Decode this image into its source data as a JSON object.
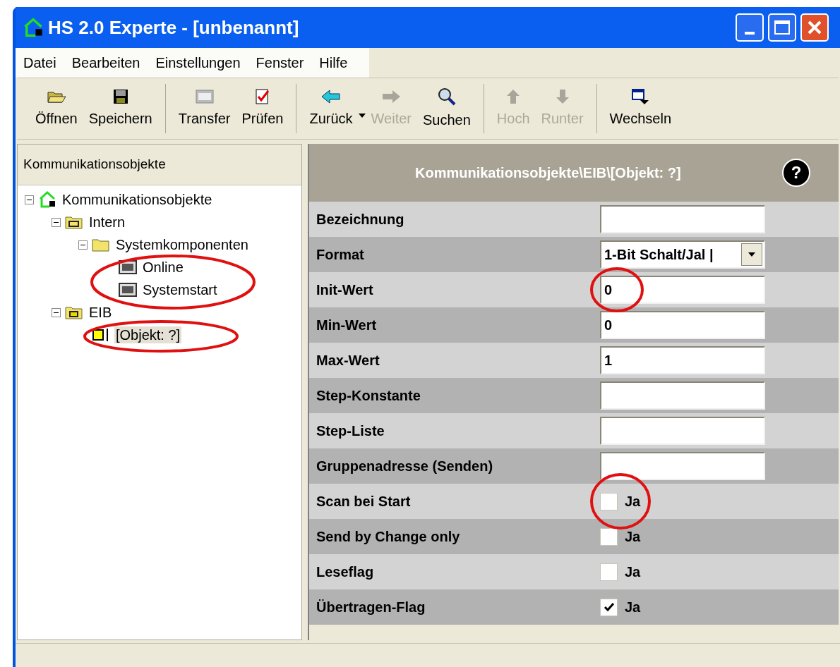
{
  "window": {
    "title": "HS 2.0 Experte - [unbenannt]"
  },
  "menu": [
    "Datei",
    "Bearbeiten",
    "Einstellungen",
    "Fenster",
    "Hilfe"
  ],
  "toolbar": [
    [
      {
        "label": "Öffnen",
        "disabled": false,
        "dropdown": false
      },
      {
        "label": "Speichern",
        "disabled": false,
        "dropdown": false
      }
    ],
    [
      {
        "label": "Transfer",
        "disabled": false,
        "dropdown": false
      },
      {
        "label": "Prüfen",
        "disabled": false,
        "dropdown": false
      }
    ],
    [
      {
        "label": "Zurück",
        "disabled": false,
        "dropdown": true
      },
      {
        "label": "Weiter",
        "disabled": true,
        "dropdown": false
      },
      {
        "label": "Suchen",
        "disabled": false,
        "dropdown": false
      }
    ],
    [
      {
        "label": "Hoch",
        "disabled": true,
        "dropdown": false
      },
      {
        "label": "Runter",
        "disabled": true,
        "dropdown": false
      }
    ],
    [
      {
        "label": "Wechseln",
        "disabled": false,
        "dropdown": false
      }
    ]
  ],
  "tree": {
    "title": "Kommunikationsobjekte",
    "items": [
      {
        "label": "Kommunikationsobjekte",
        "kind": "home",
        "expanded": true,
        "selected": false,
        "children": [
          {
            "label": "Intern",
            "kind": "hs-folder",
            "expanded": true,
            "selected": false,
            "children": [
              {
                "label": "Systemkomponenten",
                "kind": "folder",
                "expanded": true,
                "selected": false,
                "children": [
                  {
                    "label": "Online",
                    "kind": "hs-item",
                    "selected": false
                  },
                  {
                    "label": "Systemstart",
                    "kind": "hs-item",
                    "selected": false
                  }
                ]
              }
            ]
          },
          {
            "label": "EIB",
            "kind": "eib-folder",
            "expanded": true,
            "selected": false,
            "children": [
              {
                "label": "[Objekt: ?]",
                "kind": "object",
                "selected": true
              }
            ]
          }
        ]
      }
    ]
  },
  "properties": {
    "path": "Kommunikationsobjekte\\EIB\\[Objekt: ?]",
    "help": "?",
    "rows": [
      {
        "label": "Bezeichnung",
        "kind": "text"
      },
      {
        "label": "Format",
        "kind": "select",
        "value": "1-Bit Schalt/Jal |"
      },
      {
        "label": "Init-Wert",
        "kind": "text",
        "value": "0"
      },
      {
        "label": "Min-Wert",
        "kind": "text",
        "value": "0"
      },
      {
        "label": "Max-Wert",
        "kind": "text",
        "value": "1"
      },
      {
        "label": "Step-Konstante",
        "kind": "text"
      },
      {
        "label": "Step-Liste",
        "kind": "text"
      },
      {
        "label": "Gruppenadresse (Senden)",
        "kind": "text"
      },
      {
        "label": "Scan bei Start",
        "kind": "checkbox",
        "checked": false,
        "option": "Ja"
      },
      {
        "label": "Send by Change only",
        "kind": "checkbox",
        "checked": false,
        "option": "Ja"
      },
      {
        "label": "Leseflag",
        "kind": "checkbox",
        "checked": false,
        "option": "Ja"
      },
      {
        "label": "Übertragen-Flag",
        "kind": "checkbox",
        "checked": true,
        "option": "Ja"
      }
    ]
  }
}
